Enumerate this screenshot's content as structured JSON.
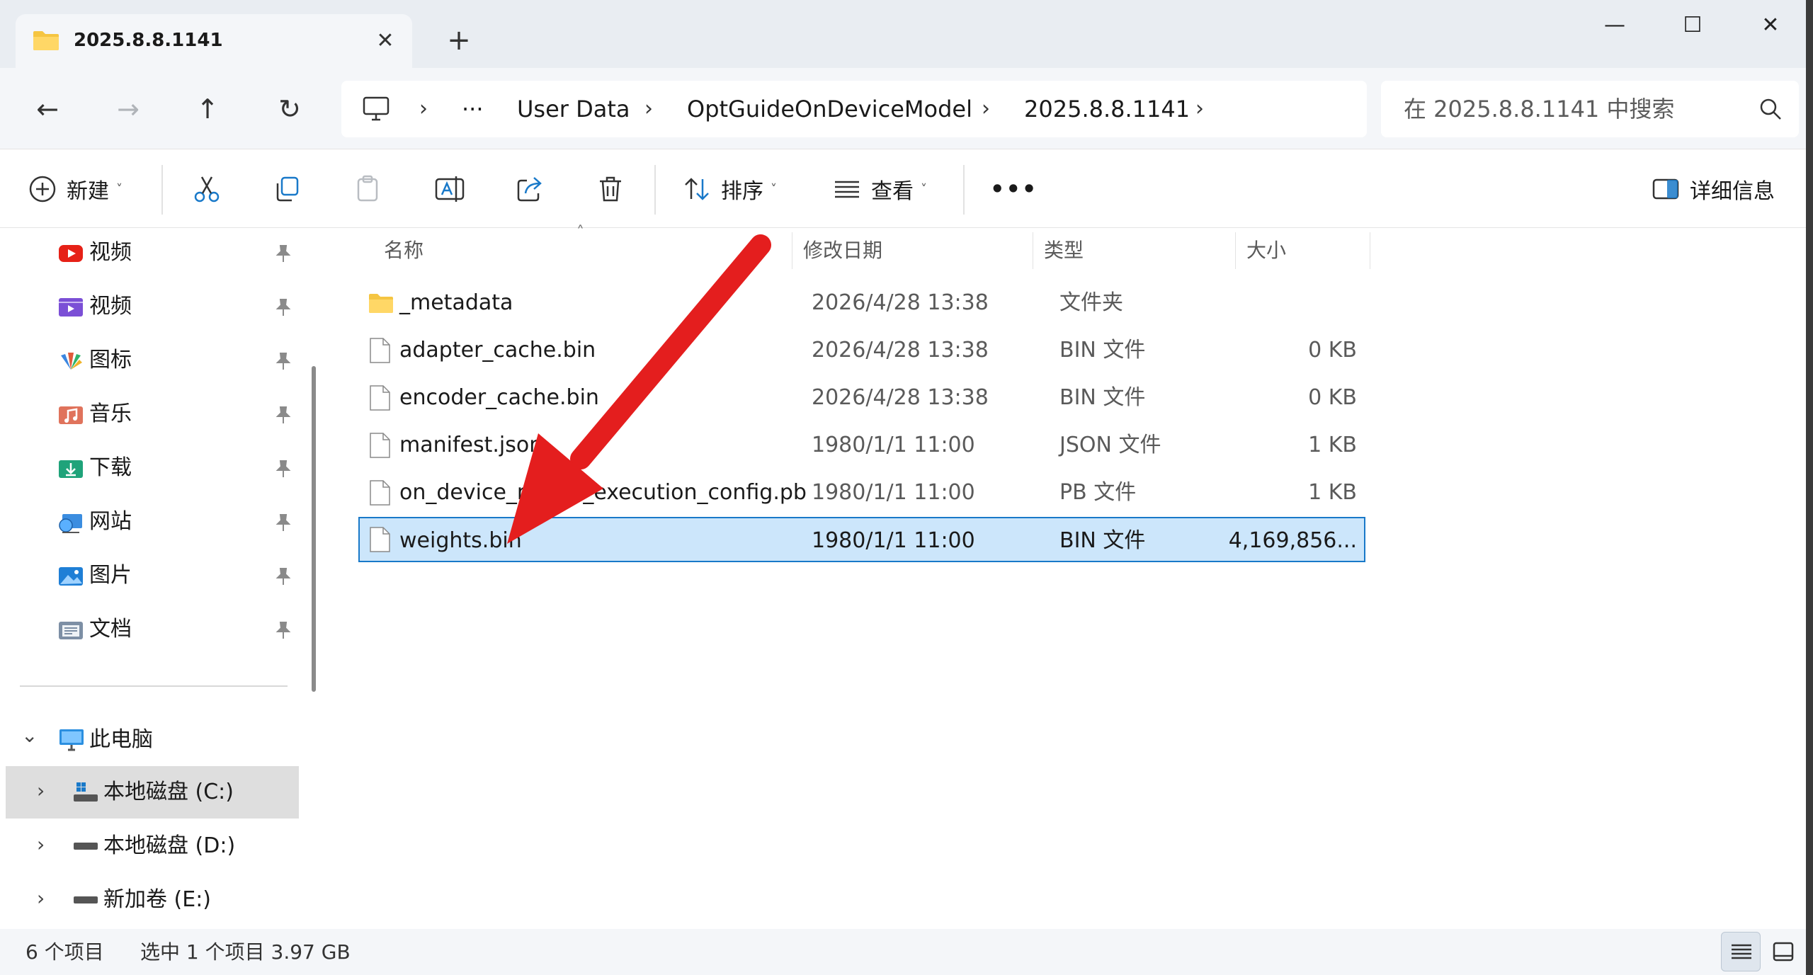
{
  "window": {
    "tab_title": "2025.8.8.1141",
    "new_tab_label": "+",
    "minimize_label": "—",
    "maximize_label": "☐",
    "close_label": "✕"
  },
  "nav": {
    "back_label": "←",
    "forward_label": "→",
    "up_label": "↑",
    "refresh_label": "↻"
  },
  "address": {
    "overflow_label": "···",
    "separator": "›",
    "crumbs": [
      "User Data",
      "OptGuideOnDeviceModel",
      "2025.8.8.1141"
    ]
  },
  "search": {
    "placeholder": "在 2025.8.8.1141 中搜索"
  },
  "toolbar": {
    "new_label": "新建",
    "sort_label": "排序",
    "view_label": "查看",
    "more_label": "•••",
    "details_label": "详细信息",
    "caret": "˅"
  },
  "sidebar": {
    "quick_access": [
      {
        "label": "视频",
        "icon": "youtube-video-icon"
      },
      {
        "label": "视频",
        "icon": "video-folder-icon"
      },
      {
        "label": "图标",
        "icon": "icons-folder-icon"
      },
      {
        "label": "音乐",
        "icon": "music-folder-icon"
      },
      {
        "label": "下载",
        "icon": "downloads-folder-icon"
      },
      {
        "label": "网站",
        "icon": "websites-folder-icon"
      },
      {
        "label": "图片",
        "icon": "pictures-folder-icon"
      },
      {
        "label": "文档",
        "icon": "documents-folder-icon"
      }
    ],
    "this_pc_label": "此电脑",
    "drives": [
      {
        "label": "本地磁盘 (C:)"
      },
      {
        "label": "本地磁盘 (D:)"
      },
      {
        "label": "新加卷 (E:)"
      }
    ],
    "collapse_chevron": "⌄",
    "expand_chevron": "›"
  },
  "columns": {
    "name": "名称",
    "date": "修改日期",
    "type": "类型",
    "size": "大小",
    "sort_indicator": "˄"
  },
  "files": [
    {
      "name": "_metadata",
      "date": "2026/4/28 13:38",
      "type": "文件夹",
      "size": "",
      "kind": "folder"
    },
    {
      "name": "adapter_cache.bin",
      "date": "2026/4/28 13:38",
      "type": "BIN 文件",
      "size": "0 KB",
      "kind": "file"
    },
    {
      "name": "encoder_cache.bin",
      "date": "2026/4/28 13:38",
      "type": "BIN 文件",
      "size": "0 KB",
      "kind": "file"
    },
    {
      "name": "manifest.json",
      "date": "1980/1/1 11:00",
      "type": "JSON 文件",
      "size": "1 KB",
      "kind": "file"
    },
    {
      "name": "on_device_model_execution_config.pb",
      "date": "1980/1/1 11:00",
      "type": "PB 文件",
      "size": "1 KB",
      "kind": "file"
    },
    {
      "name": "weights.bin",
      "date": "1980/1/1 11:00",
      "type": "BIN 文件",
      "size": "4,169,856...",
      "kind": "file",
      "selected": true
    }
  ],
  "status": {
    "item_count": "6 个项目",
    "selection": "选中 1 个项目  3.97 GB"
  },
  "colors": {
    "accent": "#1979c9",
    "selection_bg": "#cce6fb",
    "folder_yellow": "#f5c542",
    "annotation_arrow": "#e41e1e"
  }
}
